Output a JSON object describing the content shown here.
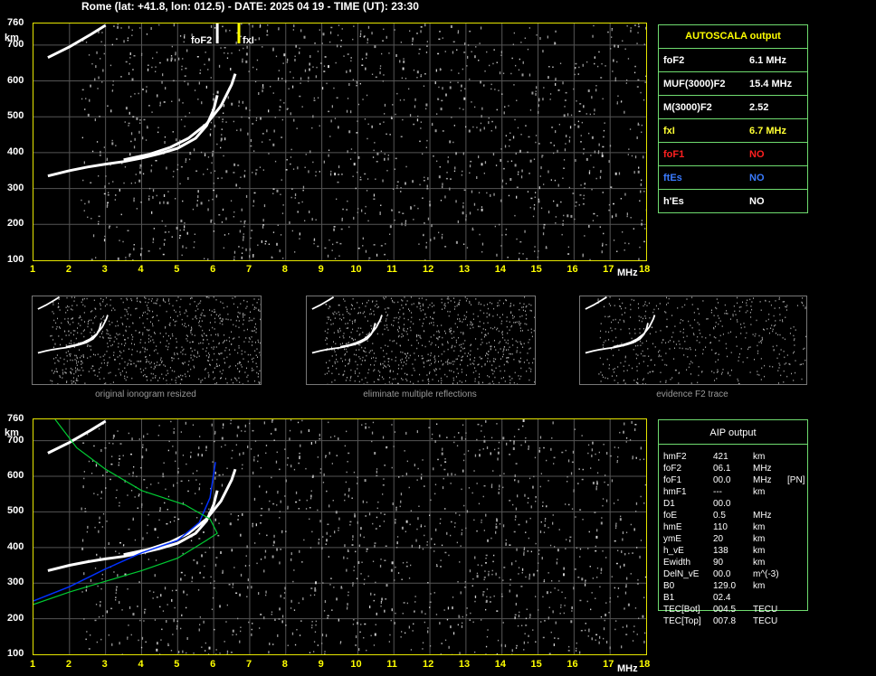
{
  "title": "Rome (lat: +41.8, lon: 012.5) - DATE: 2025 04 19 - TIME (UT): 23:30",
  "axis": {
    "y_unit": "km",
    "x_unit": "MHz",
    "y_ticks": [
      "760",
      "700",
      "600",
      "500",
      "400",
      "300",
      "200",
      "100"
    ],
    "x_ticks": [
      "1",
      "2",
      "3",
      "4",
      "5",
      "6",
      "7",
      "8",
      "9",
      "10",
      "11",
      "12",
      "13",
      "14",
      "15",
      "16",
      "17",
      "18"
    ]
  },
  "markers": {
    "foF2": "foF2",
    "fxI": "fxI"
  },
  "colors": {
    "frame": "#e6e600",
    "trace": "#ffffff",
    "profile_blue": "#0030ff",
    "profile_green": "#00cc33",
    "noise": "#9a9a9a",
    "panel_border": "#6fdc6f"
  },
  "autoscala": {
    "header": "AUTOSCALA output",
    "rows": [
      {
        "key": "foF2",
        "value": "6.1 MHz",
        "color": "#ffffff"
      },
      {
        "key": "MUF(3000)F2",
        "value": "15.4 MHz",
        "color": "#ffffff"
      },
      {
        "key": "M(3000)F2",
        "value": "2.52",
        "color": "#ffffff"
      },
      {
        "key": "fxI",
        "value": "6.7 MHz",
        "color": "#ffff33"
      },
      {
        "key": "foF1",
        "value": "NO",
        "color": "#ff2020"
      },
      {
        "key": "ftEs",
        "value": "NO",
        "color": "#3a7bff"
      },
      {
        "key": "h'Es",
        "value": "NO",
        "color": "#ffffff"
      }
    ]
  },
  "thumbnails": [
    {
      "caption": "original ionogram resized"
    },
    {
      "caption": "eliminate multiple reflections"
    },
    {
      "caption": "evidence F2 trace"
    }
  ],
  "aip": {
    "header": "AIP output",
    "rows": [
      {
        "key": "hmF2",
        "value": "421",
        "unit": "km",
        "extra": ""
      },
      {
        "key": "foF2",
        "value": "06.1",
        "unit": "MHz",
        "extra": ""
      },
      {
        "key": "foF1",
        "value": "00.0",
        "unit": "MHz",
        "extra": "[PN]"
      },
      {
        "key": "hmF1",
        "value": "---",
        "unit": "km",
        "extra": ""
      },
      {
        "key": "D1",
        "value": "00.0",
        "unit": "",
        "extra": ""
      },
      {
        "key": "foE",
        "value": "0.5",
        "unit": "MHz",
        "extra": ""
      },
      {
        "key": "hmE",
        "value": "110",
        "unit": "km",
        "extra": ""
      },
      {
        "key": "ymE",
        "value": "20",
        "unit": "km",
        "extra": ""
      },
      {
        "key": "h_vE",
        "value": "138",
        "unit": "km",
        "extra": ""
      },
      {
        "key": "Ewidth",
        "value": "90",
        "unit": "km",
        "extra": ""
      },
      {
        "key": "DelN_vE",
        "value": "00.0",
        "unit": "m^(-3)",
        "extra": ""
      },
      {
        "key": "B0",
        "value": "129.0",
        "unit": "km",
        "extra": ""
      },
      {
        "key": "B1",
        "value": "02.4",
        "unit": "",
        "extra": ""
      },
      {
        "key": "TEC[Bot]",
        "value": "004.5",
        "unit": "TECU",
        "extra": ""
      },
      {
        "key": "TEC[Top]",
        "value": "007.8",
        "unit": "TECU",
        "extra": ""
      }
    ]
  },
  "chart_data": [
    {
      "type": "scatter",
      "name_ref": "top ionogram",
      "xlim": [
        1,
        18
      ],
      "ylim": [
        100,
        760
      ],
      "grid": true,
      "series": [
        {
          "points": [
            [
              1.4,
              335
            ],
            [
              2,
              350
            ],
            [
              2.5,
              360
            ],
            [
              3,
              368
            ],
            [
              3.5,
              375
            ],
            [
              4,
              385
            ],
            [
              4.5,
              397
            ],
            [
              5,
              412
            ],
            [
              5.5,
              440
            ],
            [
              5.8,
              475
            ],
            [
              6.0,
              520
            ],
            [
              6.1,
              560
            ]
          ]
        },
        {
          "points": [
            [
              3.5,
              380
            ],
            [
              4.2,
              395
            ],
            [
              4.8,
              415
            ],
            [
              5.3,
              440
            ],
            [
              5.8,
              480
            ],
            [
              6.2,
              530
            ],
            [
              6.5,
              590
            ],
            [
              6.6,
              620
            ]
          ]
        },
        {
          "points": [
            [
              1.4,
              665
            ],
            [
              2,
              695
            ],
            [
              2.6,
              730
            ],
            [
              3.0,
              755
            ]
          ]
        }
      ],
      "annotations": [
        {
          "label": "foF2",
          "x": 6.1
        },
        {
          "label": "fxI",
          "x": 6.7
        }
      ]
    },
    {
      "type": "line",
      "name_ref": "bottom ionogram with AIP profile",
      "xlim": [
        1,
        18
      ],
      "ylim": [
        100,
        760
      ],
      "grid": true,
      "series": [
        {
          "points": [
            [
              1.4,
              335
            ],
            [
              2,
              350
            ],
            [
              2.5,
              360
            ],
            [
              3,
              368
            ],
            [
              3.5,
              375
            ],
            [
              4,
              385
            ],
            [
              4.5,
              397
            ],
            [
              5,
              412
            ],
            [
              5.5,
              440
            ],
            [
              5.8,
              475
            ],
            [
              6.0,
              520
            ],
            [
              6.1,
              560
            ]
          ]
        },
        {
          "points": [
            [
              3.5,
              380
            ],
            [
              4.2,
              395
            ],
            [
              4.8,
              415
            ],
            [
              5.3,
              440
            ],
            [
              5.8,
              480
            ],
            [
              6.2,
              530
            ],
            [
              6.5,
              590
            ],
            [
              6.6,
              620
            ]
          ]
        },
        {
          "points": [
            [
              1.4,
              665
            ],
            [
              2,
              695
            ],
            [
              2.6,
              730
            ],
            [
              3.0,
              755
            ]
          ]
        },
        {
          "points": [
            [
              1.0,
              250
            ],
            [
              2,
              290
            ],
            [
              3,
              340
            ],
            [
              4,
              385
            ],
            [
              5,
              420
            ],
            [
              5.6,
              470
            ],
            [
              5.9,
              540
            ],
            [
              6.05,
              640
            ]
          ]
        },
        {
          "points": [
            [
              1.0,
              240
            ],
            [
              2,
              275
            ],
            [
              3,
              305
            ],
            [
              4,
              335
            ],
            [
              5,
              370
            ],
            [
              5.8,
              420
            ],
            [
              6.1,
              440
            ],
            [
              5.9,
              480
            ],
            [
              5.2,
              520
            ],
            [
              4,
              560
            ],
            [
              3,
              620
            ],
            [
              2.2,
              680
            ],
            [
              1.6,
              760
            ]
          ]
        }
      ]
    }
  ]
}
